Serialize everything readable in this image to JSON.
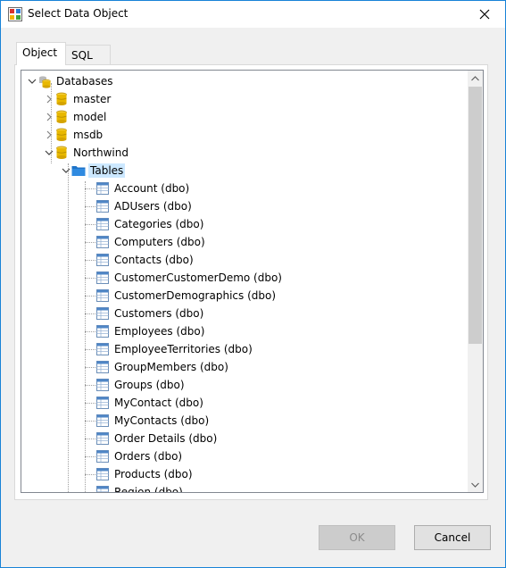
{
  "window": {
    "title": "Select Data Object"
  },
  "tabs": [
    {
      "label": "Object",
      "active": true
    },
    {
      "label": "SQL",
      "active": false
    }
  ],
  "tree": {
    "root": {
      "label": "Databases",
      "expanded": true
    },
    "databases": [
      {
        "label": "master",
        "expanded": false
      },
      {
        "label": "model",
        "expanded": false
      },
      {
        "label": "msdb",
        "expanded": false
      },
      {
        "label": "Northwind",
        "expanded": true
      }
    ],
    "folder": {
      "label": "Tables",
      "expanded": true,
      "selected": true
    },
    "tables": [
      "Account (dbo)",
      "ADUsers (dbo)",
      "Categories (dbo)",
      "Computers (dbo)",
      "Contacts (dbo)",
      "CustomerCustomerDemo (dbo)",
      "CustomerDemographics (dbo)",
      "Customers (dbo)",
      "Employees (dbo)",
      "EmployeeTerritories (dbo)",
      "GroupMembers (dbo)",
      "Groups (dbo)",
      "MyContact (dbo)",
      "MyContacts (dbo)",
      "Order Details (dbo)",
      "Orders (dbo)",
      "Products (dbo)",
      "Region (dbo)"
    ]
  },
  "buttons": {
    "ok": "OK",
    "ok_enabled": false,
    "cancel": "Cancel"
  },
  "colors": {
    "selection": "#cce8ff",
    "window_border": "#1883d7",
    "db_icon": "#e8b800",
    "folder_icon": "#1e73c8"
  }
}
